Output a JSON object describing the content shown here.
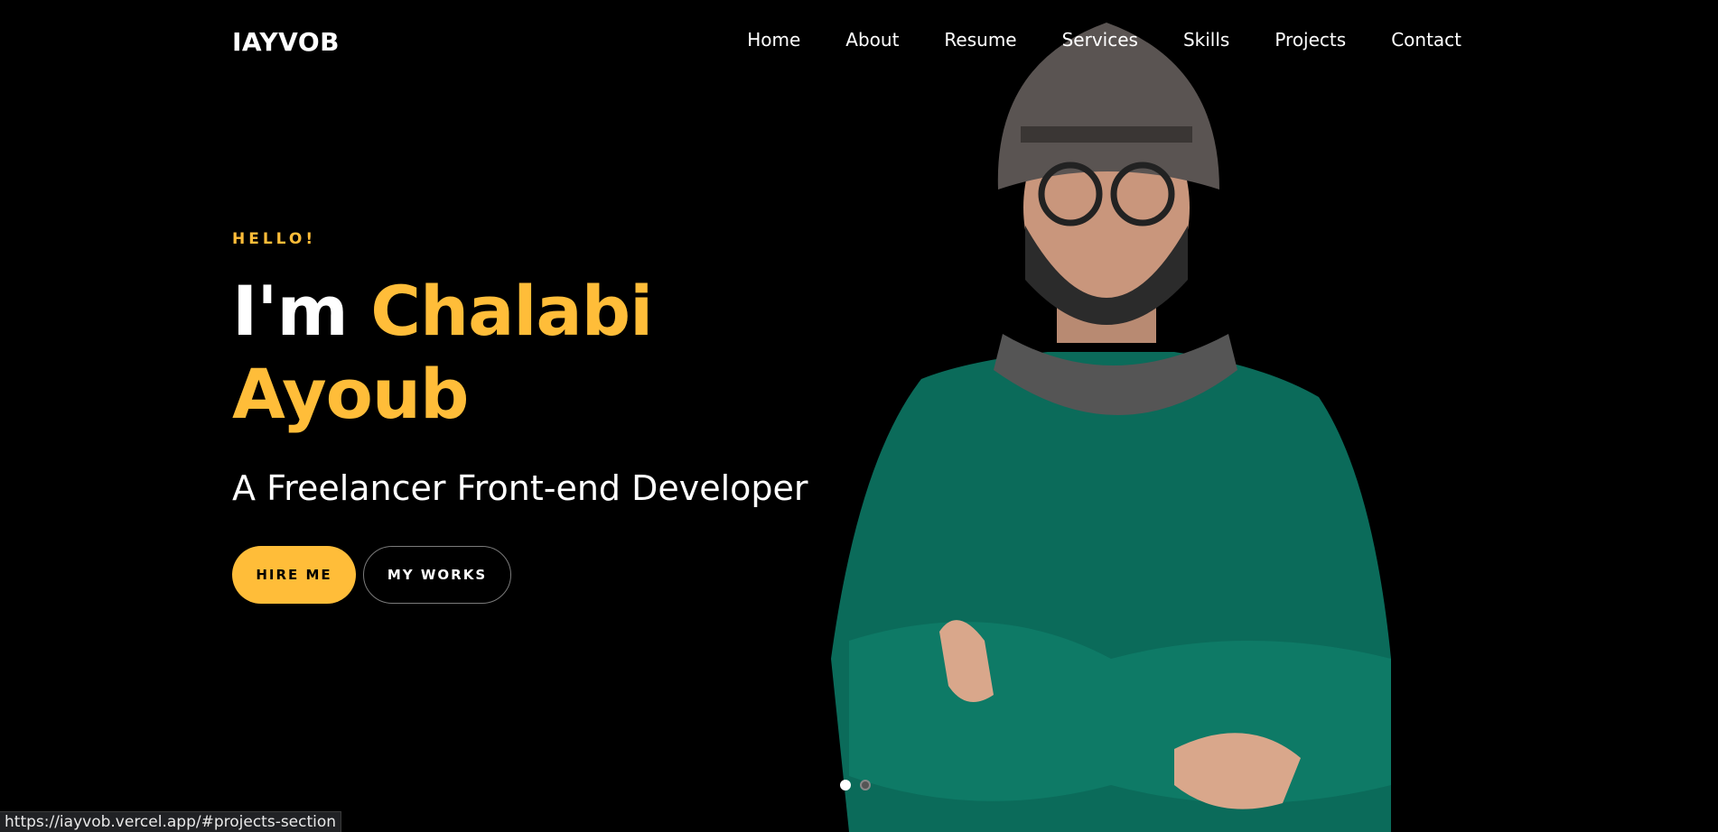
{
  "logo": "IAYVOB",
  "nav": {
    "items": [
      "Home",
      "About",
      "Resume",
      "Services",
      "Skills",
      "Projects",
      "Contact"
    ]
  },
  "hero": {
    "greeting": "HELLO!",
    "name_prefix": "I'm",
    "first_name": "Chalabi",
    "last_name": "Ayoub",
    "tagline": "A Freelancer Front-end Developer",
    "hire_label": "HIRE ME",
    "works_label": "MY WORKS"
  },
  "colors": {
    "accent": "#ffbd39",
    "background": "#000000",
    "sweater": "#0b6b5a"
  },
  "status_bar": {
    "url": "https://iayvob.vercel.app/#projects-section"
  }
}
